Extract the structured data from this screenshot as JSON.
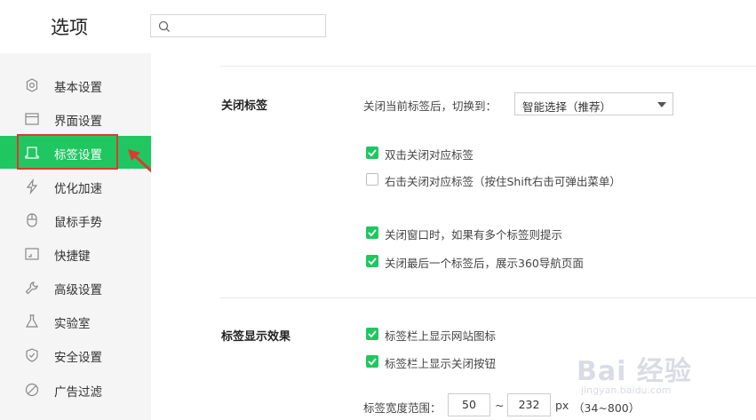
{
  "header": {
    "title": "选项",
    "search_placeholder": ""
  },
  "sidebar": {
    "items": [
      {
        "label": "基本设置",
        "icon": "gear-icon"
      },
      {
        "label": "界面设置",
        "icon": "window-icon"
      },
      {
        "label": "标签设置",
        "icon": "tab-icon",
        "active": true
      },
      {
        "label": "优化加速",
        "icon": "lightning-icon"
      },
      {
        "label": "鼠标手势",
        "icon": "mouse-icon"
      },
      {
        "label": "快捷键",
        "icon": "keyboard-icon"
      },
      {
        "label": "高级设置",
        "icon": "wrench-icon"
      },
      {
        "label": "实验室",
        "icon": "flask-icon"
      },
      {
        "label": "安全设置",
        "icon": "shield-icon"
      },
      {
        "label": "广告过滤",
        "icon": "block-icon"
      }
    ]
  },
  "close_tab": {
    "title": "关闭标签",
    "switch_label": "关闭当前标签后，切换到：",
    "switch_value": "智能选择（推荐）",
    "options": [
      {
        "label": "双击关闭对应标签",
        "checked": true
      },
      {
        "label": "右击关闭对应标签（按住Shift右击可弹出菜单）",
        "checked": false
      },
      {
        "label": "关闭窗口时，如果有多个标签则提示",
        "checked": true
      },
      {
        "label": "关闭最后一个标签后，展示360导航页面",
        "checked": true
      }
    ]
  },
  "tab_display": {
    "title": "标签显示效果",
    "options": [
      {
        "label": "标签栏上显示网站图标",
        "checked": true
      },
      {
        "label": "标签栏上显示关闭按钮",
        "checked": true
      }
    ],
    "width_label": "标签宽度范围：",
    "width_min": "50",
    "tilde": "~",
    "width_max": "232",
    "unit": "px",
    "range_hint": "（34~800）"
  },
  "watermark": {
    "logo": "Bai 经验",
    "url": "jingyan.baidu.com"
  },
  "colors": {
    "accent": "#20c760",
    "annotation": "#d93b32"
  }
}
